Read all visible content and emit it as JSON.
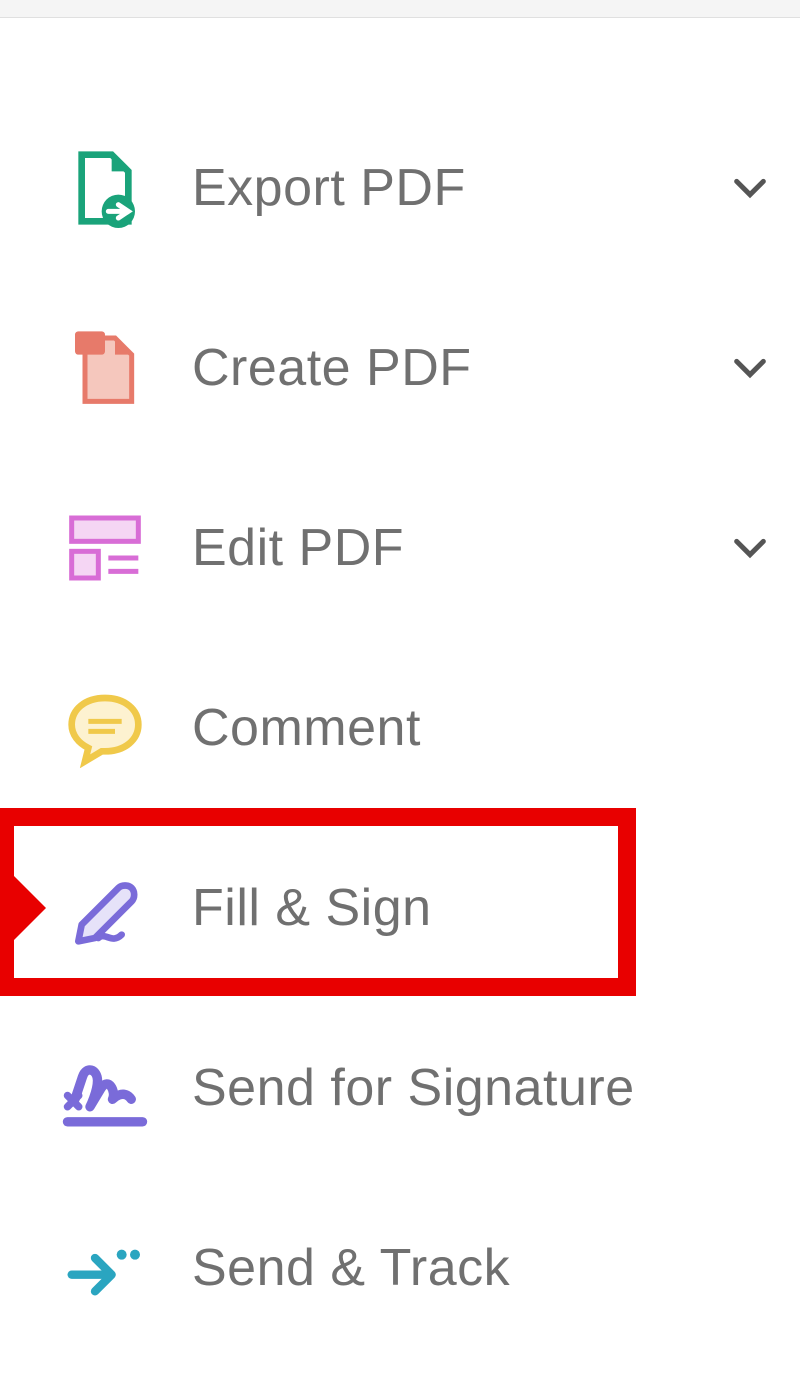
{
  "tools": [
    {
      "id": "export-pdf",
      "label": "Export PDF",
      "icon": "export-pdf-icon",
      "expandable": true,
      "highlighted": false
    },
    {
      "id": "create-pdf",
      "label": "Create PDF",
      "icon": "create-pdf-icon",
      "expandable": true,
      "highlighted": false
    },
    {
      "id": "edit-pdf",
      "label": "Edit PDF",
      "icon": "edit-pdf-icon",
      "expandable": true,
      "highlighted": false
    },
    {
      "id": "comment",
      "label": "Comment",
      "icon": "comment-icon",
      "expandable": false,
      "highlighted": false
    },
    {
      "id": "fill-sign",
      "label": "Fill & Sign",
      "icon": "fill-sign-icon",
      "expandable": false,
      "highlighted": true
    },
    {
      "id": "send-signature",
      "label": "Send for Signature",
      "icon": "send-signature-icon",
      "expandable": false,
      "highlighted": false
    },
    {
      "id": "send-track",
      "label": "Send & Track",
      "icon": "send-track-icon",
      "expandable": false,
      "highlighted": false
    }
  ],
  "colors": {
    "export": "#1aa37a",
    "create": "#e77a6a",
    "edit": "#d86dd6",
    "comment": "#f0c94a",
    "sign": "#7a6bd9",
    "track": "#2aa5c0",
    "highlight": "#e80000",
    "text": "#707070"
  }
}
